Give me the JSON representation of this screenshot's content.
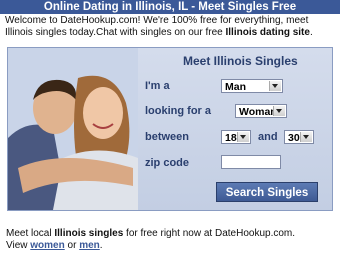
{
  "header": {
    "title": "Online Dating in Illinois, IL - Meet Singles Free"
  },
  "intro": {
    "text_1": "Welcome to DateHookup.com! We're 100% free for everything, meet Illinois singles today.Chat with singles on our free ",
    "bold": "Illinois dating site",
    "text_2": "."
  },
  "form": {
    "title": "Meet Illinois Singles",
    "iam_label": "I'm a",
    "iam_value": "Man",
    "looking_label": "looking for a",
    "looking_value": "Woman",
    "between_label": "between",
    "age_min": "18",
    "and_label": "and",
    "age_max": "30",
    "zip_label": "zip code",
    "zip_value": "",
    "search_button": "Search Singles"
  },
  "footer": {
    "text_1": "Meet local ",
    "bold": "Illinois singles",
    "text_2": " for free right now at DateHookup.com.",
    "view_text": "View ",
    "link_women": "women",
    "or_text": " or ",
    "link_men": "men",
    "end_text": "."
  },
  "colors": {
    "brand": "#3b5998",
    "panel": "#c8d3e7",
    "accent_text": "#2a3f6e"
  }
}
